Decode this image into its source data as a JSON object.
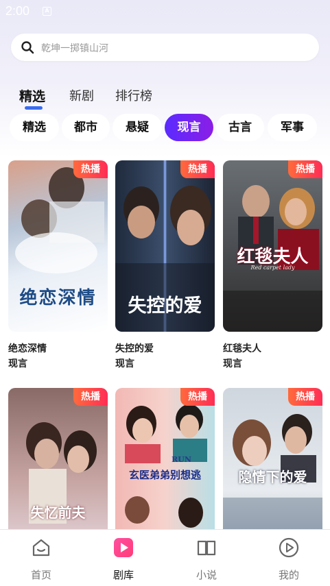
{
  "status": {
    "time": "2:00",
    "indicator": "A"
  },
  "search": {
    "placeholder": "乾坤一掷镇山河",
    "icon": "search-icon"
  },
  "tabs": [
    {
      "label": "精选",
      "active": true
    },
    {
      "label": "新剧",
      "active": false
    },
    {
      "label": "排行榜",
      "active": false
    }
  ],
  "categories": [
    {
      "label": "精选",
      "active": false
    },
    {
      "label": "都市",
      "active": false
    },
    {
      "label": "悬疑",
      "active": false
    },
    {
      "label": "现言",
      "active": true
    },
    {
      "label": "古言",
      "active": false
    },
    {
      "label": "军事",
      "active": false
    }
  ],
  "badge_label": "热播",
  "dramas": [
    {
      "title": "绝恋深情",
      "genre": "现言",
      "poster_text": "绝恋深情"
    },
    {
      "title": "失控的爱",
      "genre": "现言",
      "poster_text": "失控的爱"
    },
    {
      "title": "红毯夫人",
      "genre": "现言",
      "poster_text": "红毯夫人",
      "poster_subtext": "Red carpet lady"
    },
    {
      "title": "失忆前夫",
      "genre": "",
      "poster_text": "失忆前夫"
    },
    {
      "title": "玄医弟弟别想逃",
      "genre": "",
      "poster_text": "玄医弟弟别想逃",
      "poster_subtext": "RUN"
    },
    {
      "title": "隐情下的爱",
      "genre": "",
      "poster_text": "隐情下的爱"
    }
  ],
  "bottom_nav": [
    {
      "label": "首页",
      "icon": "home-icon",
      "active": false
    },
    {
      "label": "剧库",
      "icon": "play-library-icon",
      "active": true
    },
    {
      "label": "小说",
      "icon": "book-icon",
      "active": false
    },
    {
      "label": "我的",
      "icon": "profile-play-icon",
      "active": false
    }
  ],
  "colors": {
    "accent_gradient_start": "#5a2bff",
    "accent_gradient_end": "#8b1ee6",
    "tab_indicator": "#3b6cf0",
    "hot_badge_start": "#ff6a3c",
    "hot_badge_end": "#ff2d55",
    "nav_active_gradient_start": "#ff4fa0",
    "nav_active_gradient_end": "#ff3c78"
  }
}
